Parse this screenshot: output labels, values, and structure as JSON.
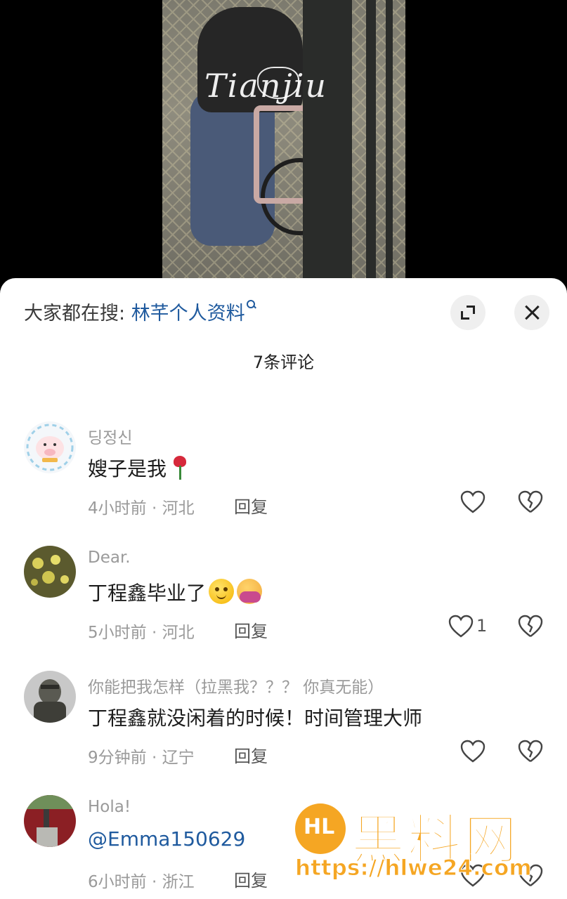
{
  "video": {
    "watermark_text": "Tianjiu"
  },
  "sheet": {
    "search_prefix": "大家都在搜: ",
    "search_term": "林芊个人资料",
    "comment_count_label": "7条评论"
  },
  "comments": [
    {
      "username": "딩정신",
      "content": "嫂子是我",
      "time_location": "4小时前 · 河北",
      "reply_label": "回复",
      "like_count": ""
    },
    {
      "username": "Dear.",
      "content": "丁程鑫毕业了",
      "time_location": "5小时前 · 河北",
      "reply_label": "回复",
      "like_count": "1"
    },
    {
      "username": "你能把我怎样（拉黑我？？？ 你真无能）",
      "content": "丁程鑫就没闲着的时候！时间管理大师",
      "time_location": "9分钟前 · 辽宁",
      "reply_label": "回复",
      "like_count": ""
    },
    {
      "username": "Hola!",
      "content": "@Emma150629",
      "time_location": "6小时前 · 浙江",
      "reply_label": "回复",
      "like_count": ""
    }
  ],
  "watermark": {
    "title": "黑料网",
    "url": "https://hlwe24.com"
  },
  "colors": {
    "link": "#1f5a9e",
    "watermark": "#f5a623"
  }
}
